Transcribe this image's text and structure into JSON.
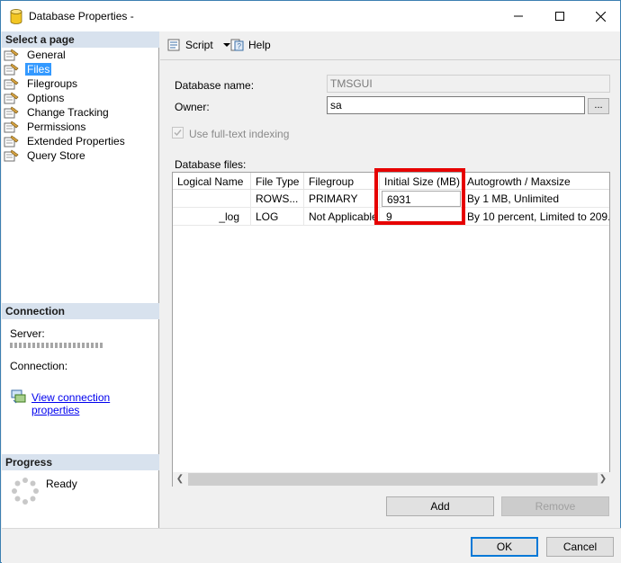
{
  "window": {
    "title": "Database Properties -"
  },
  "left_panel": {
    "select_page_heading": "Select a page",
    "pages": [
      {
        "label": "General",
        "selected": false
      },
      {
        "label": "Files",
        "selected": true
      },
      {
        "label": "Filegroups",
        "selected": false
      },
      {
        "label": "Options",
        "selected": false
      },
      {
        "label": "Change Tracking",
        "selected": false
      },
      {
        "label": "Permissions",
        "selected": false
      },
      {
        "label": "Extended Properties",
        "selected": false
      },
      {
        "label": "Query Store",
        "selected": false
      }
    ],
    "connection_heading": "Connection",
    "server_label": "Server:",
    "connection_label": "Connection:",
    "view_connection_link": "View connection properties",
    "progress_heading": "Progress",
    "progress_status": "Ready"
  },
  "toolbar": {
    "script_label": "Script",
    "help_label": "Help"
  },
  "form": {
    "database_name_label": "Database name:",
    "database_name_value": "TMSGUI",
    "owner_label": "Owner:",
    "owner_value": "sa",
    "browse_label": "...",
    "fulltext_label": "Use full-text indexing",
    "database_files_label": "Database files:"
  },
  "files_grid": {
    "columns": [
      "Logical Name",
      "File Type",
      "Filegroup",
      "Initial Size (MB)",
      "Autogrowth / Maxsize"
    ],
    "rows": [
      {
        "logical_name": "",
        "file_type": "ROWS...",
        "filegroup": "PRIMARY",
        "initial_size": "6931",
        "autogrowth": "By 1 MB, Unlimited"
      },
      {
        "logical_name": "_log",
        "file_type": "LOG",
        "filegroup": "Not Applicable",
        "initial_size": "9",
        "autogrowth": "By 10 percent, Limited to 209..."
      }
    ]
  },
  "buttons": {
    "add": "Add",
    "remove": "Remove",
    "ok": "OK",
    "cancel": "Cancel"
  },
  "colors": {
    "highlight_box": "#e60000",
    "selection": "#3399ff",
    "link": "#0000ee"
  }
}
